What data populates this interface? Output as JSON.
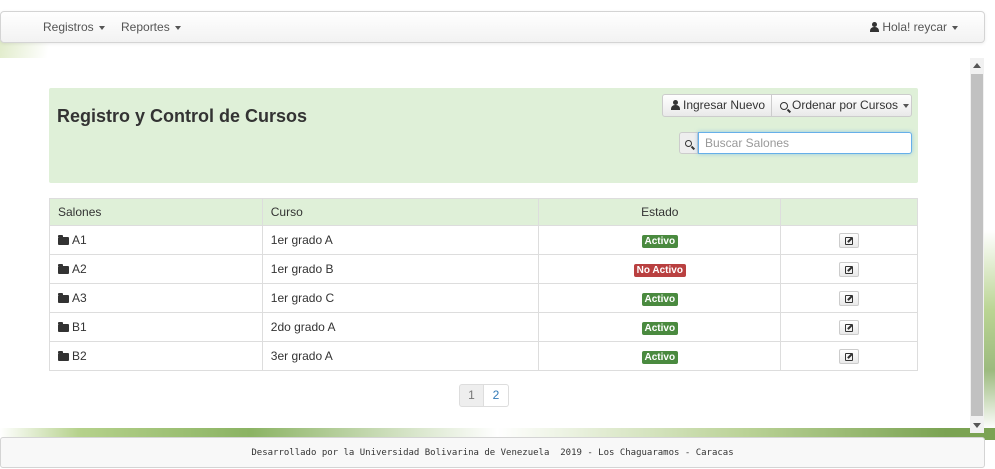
{
  "navbar": {
    "registros_label": "Registros",
    "reportes_label": "Reportes",
    "user_label": "Hola! reycar"
  },
  "header": {
    "title": "Registro y Control de Cursos",
    "new_button": "Ingresar Nuevo",
    "order_button": "Ordenar por Cursos",
    "search_placeholder": "Buscar Salones"
  },
  "table": {
    "headers": [
      "Salones",
      "Curso",
      "Estado",
      ""
    ],
    "rows": [
      {
        "salon": "A1",
        "curso": "1er grado A",
        "estado": "Activo",
        "status": "active"
      },
      {
        "salon": "A2",
        "curso": "1er grado B",
        "estado": "No Activo",
        "status": "inactive"
      },
      {
        "salon": "A3",
        "curso": "1er grado C",
        "estado": "Activo",
        "status": "active"
      },
      {
        "salon": "B1",
        "curso": "2do grado A",
        "estado": "Activo",
        "status": "active"
      },
      {
        "salon": "B2",
        "curso": "3er grado A",
        "estado": "Activo",
        "status": "active"
      }
    ]
  },
  "pagination": {
    "pages": [
      "1",
      "2"
    ],
    "current": "1"
  },
  "footer": {
    "text": "Desarrollado por la Universidad Bolivarina de Venezuela  2019 - Los Chaguaramos - Caracas"
  },
  "icons": [
    "caret-down-icon",
    "user-icon",
    "search-icon",
    "folder-open-icon",
    "edit-icon"
  ],
  "colors": {
    "panel_green": "#dff0d8",
    "label_active": "#4a8a3f",
    "label_inactive": "#b94040",
    "link_blue": "#337ab7"
  }
}
